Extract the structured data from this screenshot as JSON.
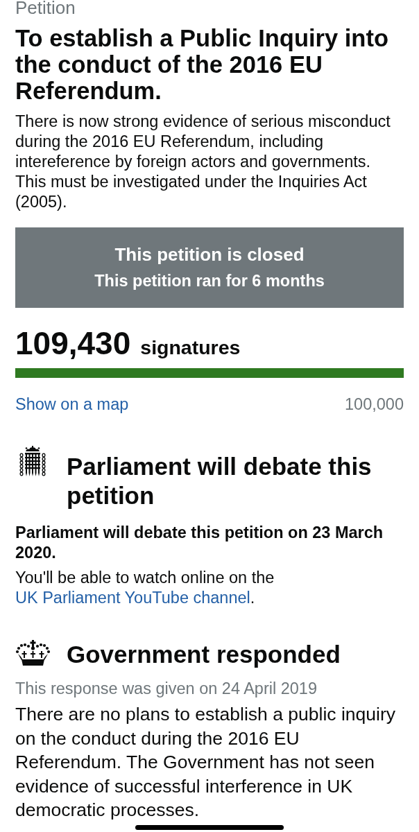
{
  "page": {
    "label": "Petition",
    "title": "To establish a Public Inquiry into the conduct of the 2016 EU Referendum."
  },
  "description": "There is now strong evidence of serious misconduct during the 2016 EU Referendum, including intereference by foreign actors and governments. This must be investigated under the Inquiries Act (2005).",
  "status_banner": {
    "title": "This petition is closed",
    "subtitle": "This petition ran for 6 months"
  },
  "signatures": {
    "count": "109,430",
    "label": "signatures",
    "level": 1,
    "map_link": "Show on a map",
    "threshold": "100,000"
  },
  "sections": [
    {
      "kind": "parliament",
      "heading": "Parliament will debate this petition",
      "paragraphs": [
        {
          "kind": "lead",
          "text": "Parliament will debate this petition on 23 March 2020."
        },
        {
          "kind": "note",
          "parts": [
            {
              "kind": "text",
              "text": "You'll be able to watch online on the "
            },
            {
              "kind": "link",
              "text": "UK Parliament YouTube channel"
            },
            {
              "kind": "text",
              "text": "."
            }
          ]
        }
      ]
    },
    {
      "kind": "government",
      "heading": "Government responded",
      "paragraphs": [
        {
          "kind": "meta",
          "text": "This response was given on 24 April 2019"
        },
        {
          "kind": "response",
          "text": "There are no plans to establish a public inquiry on the conduct during the 2016 EU Referendum. The Government has not seen evidence of successful interference in UK democratic processes."
        }
      ]
    }
  ]
}
